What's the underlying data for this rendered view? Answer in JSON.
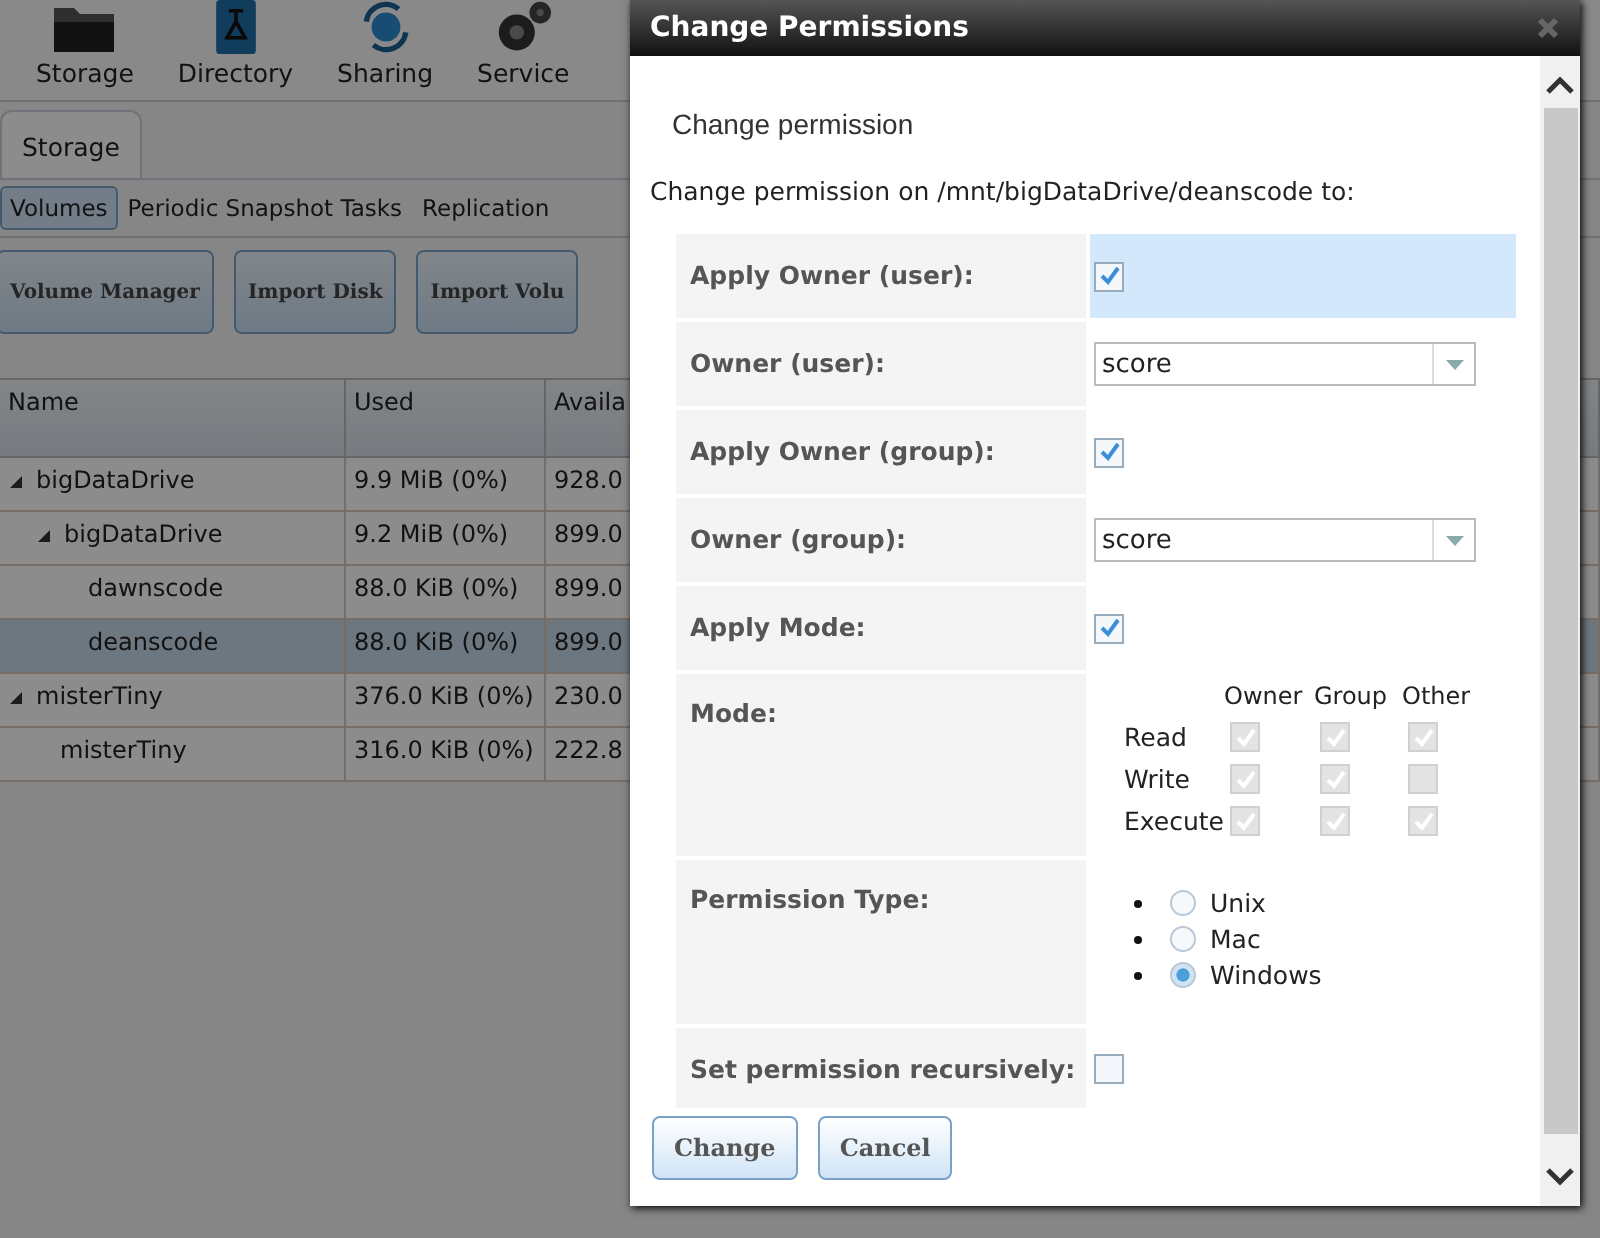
{
  "nav": [
    {
      "label": "Storage"
    },
    {
      "label": "Directory"
    },
    {
      "label": "Sharing"
    },
    {
      "label": "Service"
    }
  ],
  "tabs": [
    {
      "label": "Storage",
      "selected": true
    }
  ],
  "subtabs": [
    {
      "label": "Volumes",
      "selected": true
    },
    {
      "label": "Periodic Snapshot Tasks",
      "selected": false
    },
    {
      "label": "Replication",
      "selected": false
    }
  ],
  "toolbar_buttons": [
    "Volume Manager",
    "Import Disk",
    "Import Volu"
  ],
  "table": {
    "columns": [
      "Name",
      "Used",
      "Availa"
    ],
    "rows": [
      {
        "name": "bigDataDrive",
        "used": "9.9 MiB (0%)",
        "available": "928.0",
        "expanded": true,
        "selected": false,
        "children": [
          {
            "name": "bigDataDrive",
            "used": "9.2 MiB (0%)",
            "available": "899.0",
            "expanded": true,
            "selected": false,
            "children": [
              {
                "name": "dawnscode",
                "used": "88.0 KiB (0%)",
                "available": "899.0",
                "selected": false
              },
              {
                "name": "deanscode",
                "used": "88.0 KiB (0%)",
                "available": "899.0",
                "selected": true
              }
            ]
          }
        ]
      },
      {
        "name": "misterTiny",
        "used": "376.0 KiB (0%)",
        "available": "230.0",
        "expanded": true,
        "selected": false,
        "children": [
          {
            "name": "misterTiny",
            "used": "316.0 KiB (0%)",
            "available": "222.8",
            "selected": false
          }
        ]
      }
    ]
  },
  "dialog": {
    "title": "Change Permissions",
    "heading": "Change permission",
    "intro": "Change permission on /mnt/bigDataDrive/deanscode to:",
    "fields": [
      {
        "kind": "checkbox",
        "label": "Apply Owner (user):",
        "checked": true,
        "highlighted": true
      },
      {
        "kind": "select",
        "label": "Owner (user):",
        "value": "score",
        "highlighted": false
      },
      {
        "kind": "checkbox",
        "label": "Apply Owner (group):",
        "checked": true,
        "highlighted": false
      },
      {
        "kind": "select",
        "label": "Owner (group):",
        "value": "score",
        "highlighted": false
      },
      {
        "kind": "checkbox",
        "label": "Apply Mode:",
        "checked": true,
        "highlighted": false
      },
      {
        "kind": "mode",
        "label": "Mode:",
        "highlighted": false,
        "disabled": true,
        "columns": [
          "Owner",
          "Group",
          "Other"
        ],
        "rows": [
          {
            "label": "Read",
            "checks": [
              true,
              true,
              true
            ]
          },
          {
            "label": "Write",
            "checks": [
              true,
              true,
              false
            ]
          },
          {
            "label": "Execute",
            "checks": [
              true,
              true,
              true
            ]
          }
        ]
      },
      {
        "kind": "radio",
        "label": "Permission Type:",
        "highlighted": false,
        "options": [
          {
            "label": "Unix",
            "selected": false
          },
          {
            "label": "Mac",
            "selected": false
          },
          {
            "label": "Windows",
            "selected": true
          }
        ]
      },
      {
        "kind": "checkbox",
        "label": "Set permission recursively:",
        "checked": false,
        "highlighted": false
      }
    ],
    "buttons": [
      "Change",
      "Cancel"
    ]
  }
}
